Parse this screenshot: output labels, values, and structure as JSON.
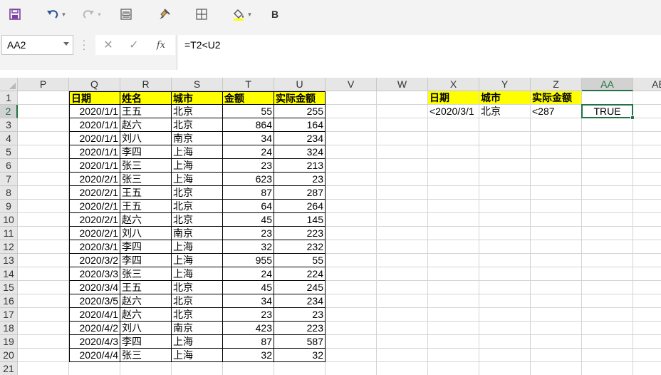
{
  "toolbar": {
    "save_icon": "save-icon",
    "undo_icon": "undo-icon",
    "redo_icon": "redo-icon",
    "form_icon": "form-icon",
    "brush_icon": "format-painter-icon",
    "borders_icon": "borders-icon",
    "fill_icon": "fill-color-icon",
    "bold_label": "B"
  },
  "formula_bar": {
    "name_box": "AA2",
    "cancel_symbol": "✕",
    "confirm_symbol": "✓",
    "fx_label": "fx",
    "formula": "=T2<U2"
  },
  "columns": [
    "P",
    "Q",
    "R",
    "S",
    "T",
    "U",
    "V",
    "W",
    "X",
    "Y",
    "Z",
    "AA",
    "AB"
  ],
  "rows": [
    "1",
    "2",
    "3",
    "4",
    "5",
    "6",
    "7",
    "8",
    "9",
    "10",
    "11",
    "12",
    "13",
    "14",
    "15",
    "16",
    "17",
    "18",
    "19",
    "20",
    "21"
  ],
  "selected": {
    "column": "AA",
    "row": "2"
  },
  "table": {
    "headers": [
      "日期",
      "姓名",
      "城市",
      "金额",
      "实际金额"
    ],
    "rows": [
      [
        "2020/1/1",
        "王五",
        "北京",
        "55",
        "255"
      ],
      [
        "2020/1/1",
        "赵六",
        "北京",
        "864",
        "164"
      ],
      [
        "2020/1/1",
        "刘八",
        "南京",
        "34",
        "234"
      ],
      [
        "2020/1/1",
        "李四",
        "上海",
        "24",
        "324"
      ],
      [
        "2020/1/1",
        "张三",
        "上海",
        "23",
        "213"
      ],
      [
        "2020/2/1",
        "张三",
        "上海",
        "623",
        "23"
      ],
      [
        "2020/2/1",
        "王五",
        "北京",
        "87",
        "287"
      ],
      [
        "2020/2/1",
        "王五",
        "北京",
        "64",
        "264"
      ],
      [
        "2020/2/1",
        "赵六",
        "北京",
        "45",
        "145"
      ],
      [
        "2020/2/1",
        "刘八",
        "南京",
        "23",
        "223"
      ],
      [
        "2020/3/1",
        "李四",
        "上海",
        "32",
        "232"
      ],
      [
        "2020/3/2",
        "李四",
        "上海",
        "955",
        "55"
      ],
      [
        "2020/3/3",
        "张三",
        "上海",
        "24",
        "224"
      ],
      [
        "2020/3/4",
        "王五",
        "北京",
        "45",
        "245"
      ],
      [
        "2020/3/5",
        "赵六",
        "北京",
        "34",
        "234"
      ],
      [
        "2020/4/1",
        "赵六",
        "北京",
        "23",
        "23"
      ],
      [
        "2020/4/2",
        "刘八",
        "南京",
        "423",
        "223"
      ],
      [
        "2020/4/3",
        "李四",
        "上海",
        "87",
        "587"
      ],
      [
        "2020/4/4",
        "张三",
        "上海",
        "32",
        "32"
      ]
    ]
  },
  "criteria": {
    "headers": [
      "日期",
      "城市",
      "实际金额"
    ],
    "values": [
      "<2020/3/1",
      "北京",
      "<287"
    ],
    "result": "TRUE"
  },
  "colors": {
    "header_fill": "#ffff00",
    "selection": "#217346",
    "toolbar_bg": "#f3f3f3"
  }
}
